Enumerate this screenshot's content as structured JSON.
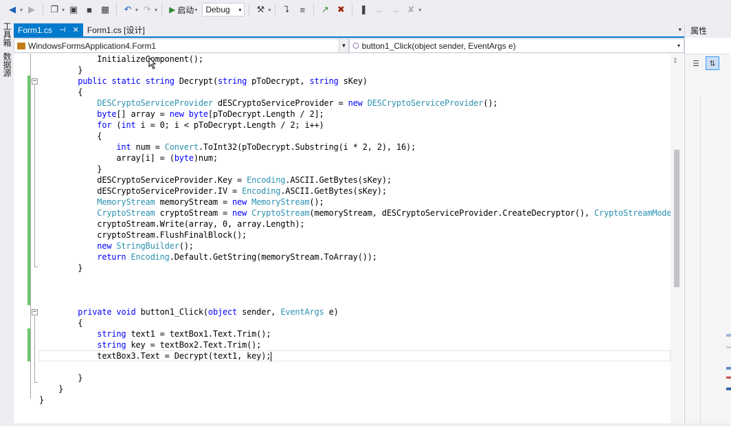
{
  "toolbar": {
    "start_label": "启动",
    "config_value": "Debug",
    "buttons": [
      "back-icon",
      "forward-icon",
      "new-project-icon",
      "open-icon",
      "save-icon",
      "save-all-icon",
      "undo-icon",
      "redo-icon",
      "start-icon",
      "attach-icon",
      "bookmark-icon"
    ]
  },
  "left_strip": {
    "toolbox_label": "工具箱",
    "datasource_label": "数据源"
  },
  "tabs": [
    {
      "label": "Form1.cs",
      "active": true
    },
    {
      "label": "Form1.cs [设计]",
      "active": false
    }
  ],
  "navbar": {
    "class_value": "WindowsFormsApplication4.Form1",
    "member_value": "button1_Click(object sender, EventArgs e)"
  },
  "right_panel": {
    "title": "属性"
  },
  "code": {
    "lines": [
      "            InitializeComponent();",
      "        }",
      "        public static string Decrypt(string pToDecrypt, string sKey)",
      "        {",
      "            DESCryptoServiceProvider dESCryptoServiceProvider = new DESCryptoServiceProvider();",
      "            byte[] array = new byte[pToDecrypt.Length / 2];",
      "            for (int i = 0; i < pToDecrypt.Length / 2; i++)",
      "            {",
      "                int num = Convert.ToInt32(pToDecrypt.Substring(i * 2, 2), 16);",
      "                array[i] = (byte)num;",
      "            }",
      "            dESCryptoServiceProvider.Key = Encoding.ASCII.GetBytes(sKey);",
      "            dESCryptoServiceProvider.IV = Encoding.ASCII.GetBytes(sKey);",
      "            MemoryStream memoryStream = new MemoryStream();",
      "            CryptoStream cryptoStream = new CryptoStream(memoryStream, dESCryptoServiceProvider.CreateDecryptor(), CryptoStreamMode.",
      "            cryptoStream.Write(array, 0, array.Length);",
      "            cryptoStream.FlushFinalBlock();",
      "            new StringBuilder();",
      "            return Encoding.Default.GetString(memoryStream.ToArray());",
      "        }",
      "",
      "",
      "",
      "        private void button1_Click(object sender, EventArgs e)",
      "        {",
      "            string text1 = textBox1.Text.Trim();",
      "            string key = textBox2.Text.Trim();",
      "            textBox3.Text = Decrypt(text1, key);",
      "",
      "        }",
      "    }",
      "}"
    ],
    "keywords": [
      "public",
      "static",
      "string",
      "new",
      "byte",
      "for",
      "int",
      "return",
      "private",
      "void",
      "object"
    ],
    "types": [
      "DESCryptoServiceProvider",
      "Convert",
      "Encoding",
      "MemoryStream",
      "CryptoStream",
      "CryptoStreamMode",
      "StringBuilder",
      "EventArgs"
    ],
    "caret_line": 27
  }
}
